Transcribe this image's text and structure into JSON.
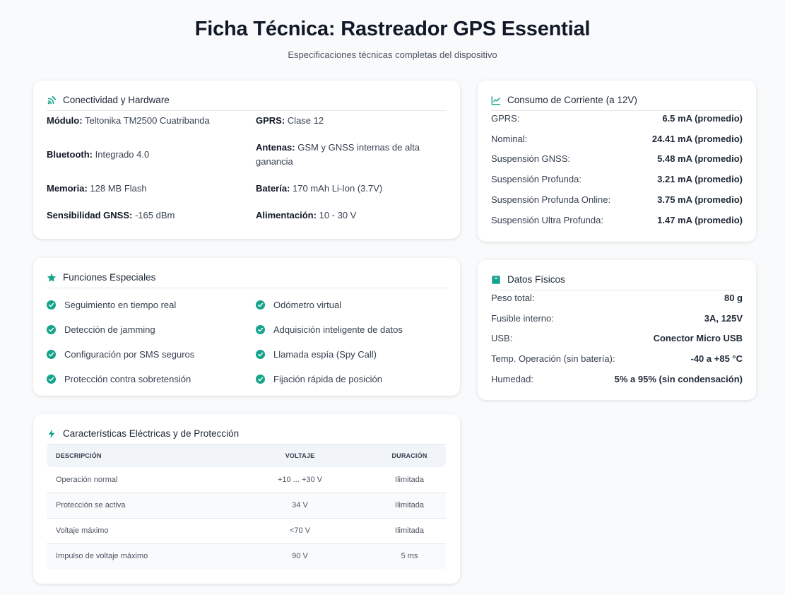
{
  "header": {
    "title": "Ficha Técnica: Rastreador GPS Essential",
    "subtitle": "Especificaciones técnicas completas del dispositivo"
  },
  "colors": {
    "accent": "#14a38b",
    "text": "#374151",
    "heading": "#111827"
  },
  "connectivity": {
    "title": "Conectividad y Hardware",
    "icon": "satellite-icon",
    "specs": [
      {
        "label": "Módulo:",
        "value": "Teltonika TM2500 Cuatribanda"
      },
      {
        "label": "GPRS:",
        "value": "Clase 12"
      },
      {
        "label": "Bluetooth:",
        "value": "Integrado 4.0"
      },
      {
        "label": "Antenas:",
        "value": "GSM y GNSS internas de alta ganancia"
      },
      {
        "label": "Memoria:",
        "value": "128 MB Flash"
      },
      {
        "label": "Batería:",
        "value": "170 mAh Li-Ion (3.7V)"
      },
      {
        "label": "Sensibilidad GNSS:",
        "value": "-165 dBm"
      },
      {
        "label": "Alimentación:",
        "value": "10 - 30 V"
      }
    ]
  },
  "features": {
    "title": "Funciones Especiales",
    "icon": "star-icon",
    "items": [
      "Seguimiento en tiempo real",
      "Odómetro virtual",
      "Detección de jamming",
      "Adquisición inteligente de datos",
      "Configuración por SMS seguros",
      "Llamada espía (Spy Call)",
      "Protección contra sobretensión",
      "Fijación rápida de posición"
    ]
  },
  "electrical": {
    "title": "Características Eléctricas y de Protección",
    "icon": "bolt-icon",
    "columns": [
      "Descripción",
      "Voltaje",
      "Duración"
    ],
    "rows": [
      [
        "Operación normal",
        "+10 ... +30 V",
        "Ilimitada"
      ],
      [
        "Protección se activa",
        "34 V",
        "Ilimitada"
      ],
      [
        "Voltaje máximo",
        "<70 V",
        "Ilimitada"
      ],
      [
        "Impulso de voltaje máximo",
        "90 V",
        "5 ms"
      ]
    ]
  },
  "consumption": {
    "title": "Consumo de Corriente (a 12V)",
    "icon": "line-chart-icon",
    "rows": [
      {
        "label": "GPRS:",
        "value": "6.5 mA (promedio)"
      },
      {
        "label": "Nominal:",
        "value": "24.41 mA (promedio)"
      },
      {
        "label": "Suspensión GNSS:",
        "value": "5.48 mA (promedio)"
      },
      {
        "label": "Suspensión Profunda:",
        "value": "3.21 mA (promedio)"
      },
      {
        "label": "Suspensión Profunda Online:",
        "value": "3.75 mA (promedio)"
      },
      {
        "label": "Suspensión Ultra Profunda:",
        "value": "1.47 mA (promedio)"
      }
    ]
  },
  "physical": {
    "title": "Datos Físicos",
    "icon": "box-icon",
    "rows": [
      {
        "label": "Peso total:",
        "value": "80 g"
      },
      {
        "label": "Fusible interno:",
        "value": "3A, 125V"
      },
      {
        "label": "USB:",
        "value": "Conector Micro USB"
      },
      {
        "label": "Temp. Operación (sin batería):",
        "value": "-40 a +85 °C"
      },
      {
        "label": "Humedad:",
        "value": "5% a 95% (sin condensación)"
      }
    ]
  }
}
